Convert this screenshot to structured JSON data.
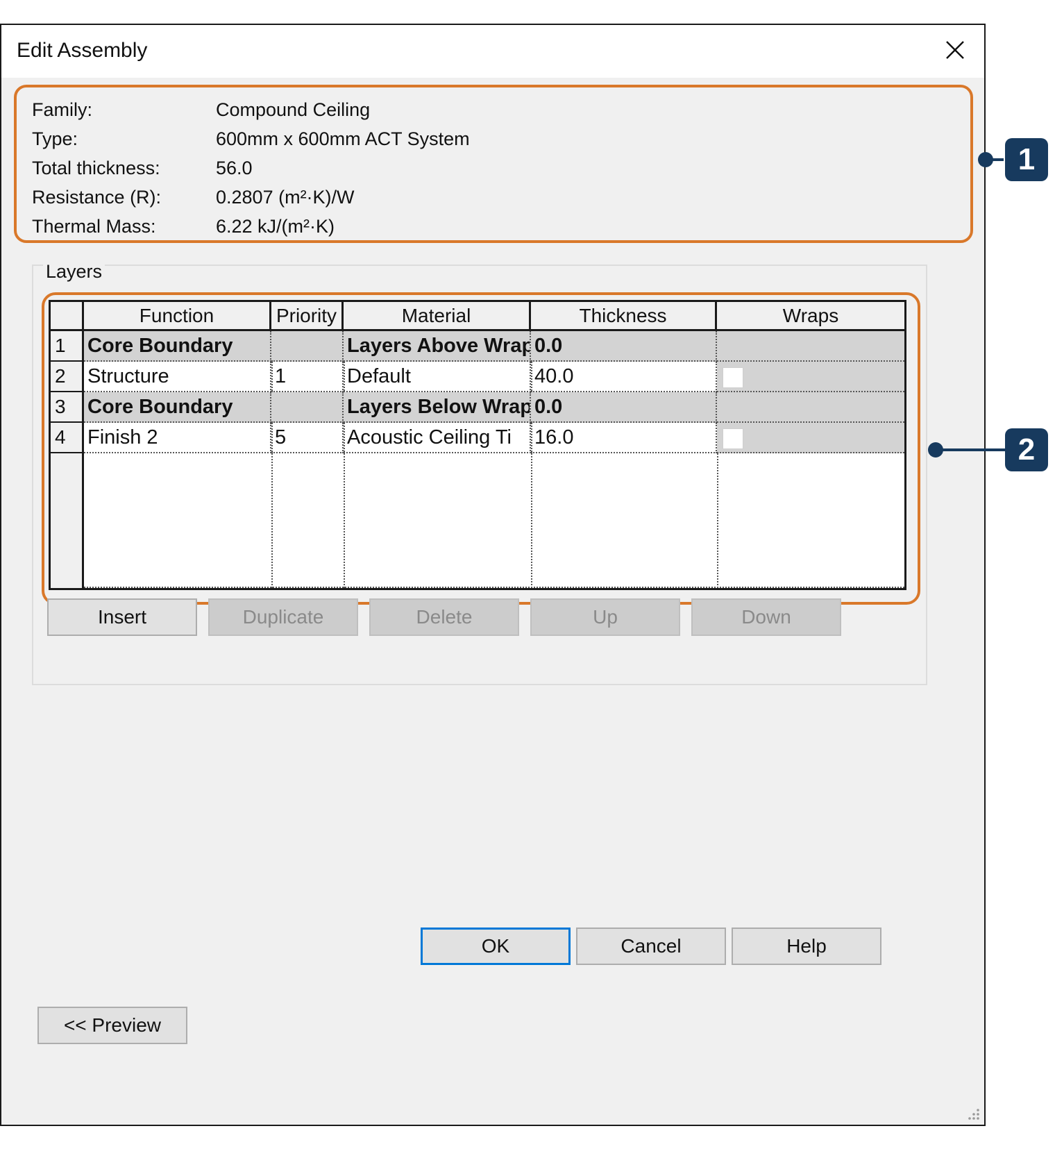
{
  "window": {
    "title": "Edit Assembly"
  },
  "info": {
    "rows": [
      {
        "label": "Family:",
        "value": "Compound Ceiling"
      },
      {
        "label": "Type:",
        "value": "600mm x 600mm ACT System"
      },
      {
        "label": "Total thickness:",
        "value": "56.0"
      },
      {
        "label": "Resistance (R):",
        "value": "0.2807 (m²·K)/W"
      },
      {
        "label": "Thermal Mass:",
        "value": "6.22 kJ/(m²·K)"
      }
    ]
  },
  "layers": {
    "group_label": "Layers",
    "columns": [
      "Function",
      "Priority",
      "Material",
      "Thickness",
      "Wraps"
    ],
    "rows": [
      {
        "num": "1",
        "function": "Core Boundary",
        "priority": "",
        "material": "Layers Above Wrap",
        "thickness": "0.0",
        "wraps": null,
        "boundary": true
      },
      {
        "num": "2",
        "function": "Structure",
        "priority": "1",
        "material": "Default",
        "thickness": "40.0",
        "wraps": false,
        "boundary": false
      },
      {
        "num": "3",
        "function": "Core Boundary",
        "priority": "",
        "material": "Layers Below Wrap",
        "thickness": "0.0",
        "wraps": null,
        "boundary": true
      },
      {
        "num": "4",
        "function": "Finish 2",
        "priority": "5",
        "material": "Acoustic Ceiling Ti",
        "thickness": "16.0",
        "wraps": false,
        "boundary": false
      }
    ]
  },
  "layer_buttons": {
    "insert": "Insert",
    "duplicate": "Duplicate",
    "delete": "Delete",
    "up": "Up",
    "down": "Down"
  },
  "footer": {
    "ok": "OK",
    "cancel": "Cancel",
    "help": "Help",
    "preview": "<< Preview"
  },
  "callouts": {
    "one": "1",
    "two": "2"
  },
  "colors": {
    "highlight": "#d9782a",
    "callout": "#173a5e",
    "default_button_border": "#0078d7"
  }
}
